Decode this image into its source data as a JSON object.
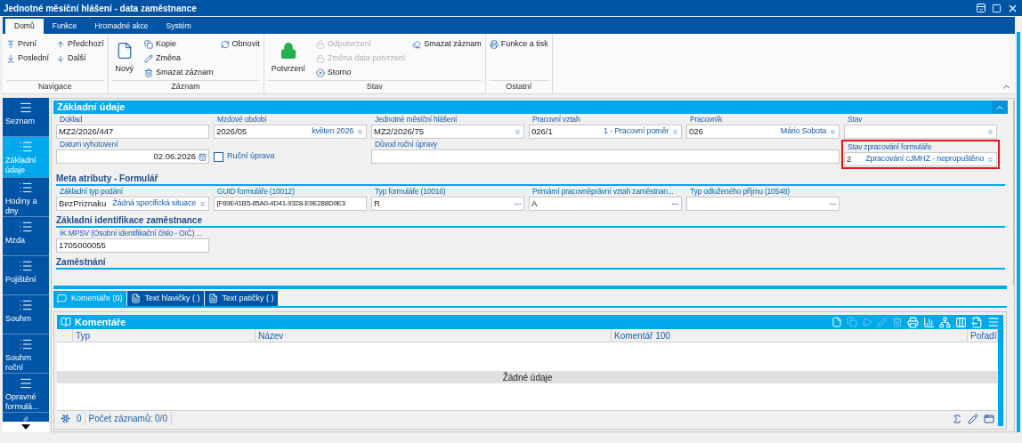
{
  "window": {
    "title": "Jednotné měsíční hlášení - data zaměstnance"
  },
  "ribbon": {
    "tabs": [
      {
        "label": "Domů",
        "selected": true
      },
      {
        "label": "Funkce",
        "selected": false
      },
      {
        "label": "Hromadné akce",
        "selected": false
      },
      {
        "label": "Systém",
        "selected": false
      }
    ],
    "groups": [
      {
        "label": "Navigace",
        "columns": [
          [
            {
              "label": "První",
              "disabled": false
            },
            {
              "label": "Poslední",
              "disabled": false
            }
          ],
          [
            {
              "label": "Předchozí",
              "disabled": false
            },
            {
              "label": "Další",
              "disabled": false
            }
          ]
        ]
      },
      {
        "label": "Záznam",
        "columns": [
          [
            {
              "label": "Nový",
              "disabled": false,
              "kind": "large"
            }
          ],
          [
            {
              "label": "Kopie",
              "disabled": false
            },
            {
              "label": "Změna",
              "disabled": false
            },
            {
              "label": "Smazat záznam",
              "disabled": false
            }
          ],
          [
            {
              "label": "Obnovit",
              "disabled": false
            }
          ]
        ]
      },
      {
        "label": "Stav",
        "columns": [
          [
            {
              "label": "Potvrzení",
              "disabled": false,
              "kind": "large"
            }
          ],
          [
            {
              "label": "Odpotvrzení",
              "disabled": true
            },
            {
              "label": "Změna data potvrzení",
              "disabled": true
            },
            {
              "label": "Storno",
              "disabled": false
            }
          ],
          [
            {
              "label": "Smazat záznam",
              "disabled": false
            }
          ]
        ]
      },
      {
        "label": "Ostatní",
        "columns": [
          [
            {
              "label": "Funkce a tisk",
              "disabled": false
            }
          ]
        ]
      }
    ]
  },
  "sidebar": {
    "items": [
      {
        "label": "Seznam",
        "selected": false
      },
      {
        "label": "Základní údaje",
        "selected": true
      },
      {
        "label": "Hodiny a dny",
        "selected": false
      },
      {
        "label": "Mzda",
        "selected": false
      },
      {
        "label": "Pojištění",
        "selected": false
      },
      {
        "label": "Souhrn",
        "selected": false
      },
      {
        "label": "Souhrn roční",
        "selected": false
      },
      {
        "label": "Opravné formulá...",
        "selected": false
      }
    ]
  },
  "form": {
    "sections": [
      {
        "title": "Základní údaje",
        "kind": "header",
        "fields": [
          {
            "label": "Doklad",
            "value": "MZ2/2026/447",
            "kind": "text"
          },
          {
            "label": "Mzdové období",
            "value": "2026/05",
            "description": "květen 2026",
            "kind": "dropdown"
          },
          {
            "label": "Jednotné měsíční hlášení",
            "value": "MZ2/2026/75",
            "kind": "dropdown"
          },
          {
            "label": "Pracovní vztah",
            "value": "026/1",
            "description": "1 - Pracovní poměr",
            "kind": "dropdown"
          },
          {
            "label": "Pracovník",
            "value": "026",
            "description": "Mário Sobota",
            "kind": "dropdown"
          },
          {
            "label": "Stav",
            "kind": "dropdown"
          },
          {
            "label": "Datum vyhotovení",
            "value": "02.06.2026",
            "kind": "date"
          },
          {
            "label": "Ruční úprava",
            "kind": "checkbox",
            "checked": false
          },
          {
            "label": "Důvod ruční úpravy",
            "kind": "memo"
          },
          {
            "label": "Stav zpracování formuláře",
            "value": "2",
            "description": "Zpracování cJMHZ - nepropuštěno",
            "kind": "dropdown",
            "highlighted": true
          }
        ]
      },
      {
        "title": "Meta atributy - Formulář",
        "kind": "subheader",
        "fields": [
          {
            "label": "Základní typ podání",
            "value": "BezPriznaku",
            "description": "Žádná specifická situace",
            "kind": "dropdown"
          },
          {
            "label": "GUID formuláře (10012)",
            "value": "{F69E41B5-85A0-4D41-9328-E9E288D9E3",
            "kind": "text"
          },
          {
            "label": "Typ formuláře (10016)",
            "value": "R",
            "kind": "lookup"
          },
          {
            "label": "Primární pracovněprávní vztah zaměstnan...",
            "value": "A",
            "kind": "lookup"
          },
          {
            "label": "Typ odloženého příjmu (10548)",
            "kind": "lookup"
          }
        ]
      },
      {
        "title": "Základní identifikace zaměstnance",
        "kind": "subheader",
        "fields": [
          {
            "label": "IK MPSV (Osobní identifikační číslo - OIČ) ...",
            "value": "1705000055",
            "kind": "text"
          }
        ]
      },
      {
        "title": "Zaměstnání",
        "kind": "subheader"
      }
    ]
  },
  "bottom_tabs": [
    {
      "label": "Komentáře (0)",
      "selected": true
    },
    {
      "label": "Text hlavičky ( )",
      "selected": false
    },
    {
      "label": "Text patičky ( )",
      "selected": false
    }
  ],
  "grid": {
    "title": "Komentáře",
    "columns": [
      "Typ",
      "Název",
      "Komentář 100",
      "Pořadí"
    ],
    "empty_message": "Žádné údaje",
    "footer": {
      "count": "0",
      "records": "Počet záznamů: 0/0"
    }
  }
}
